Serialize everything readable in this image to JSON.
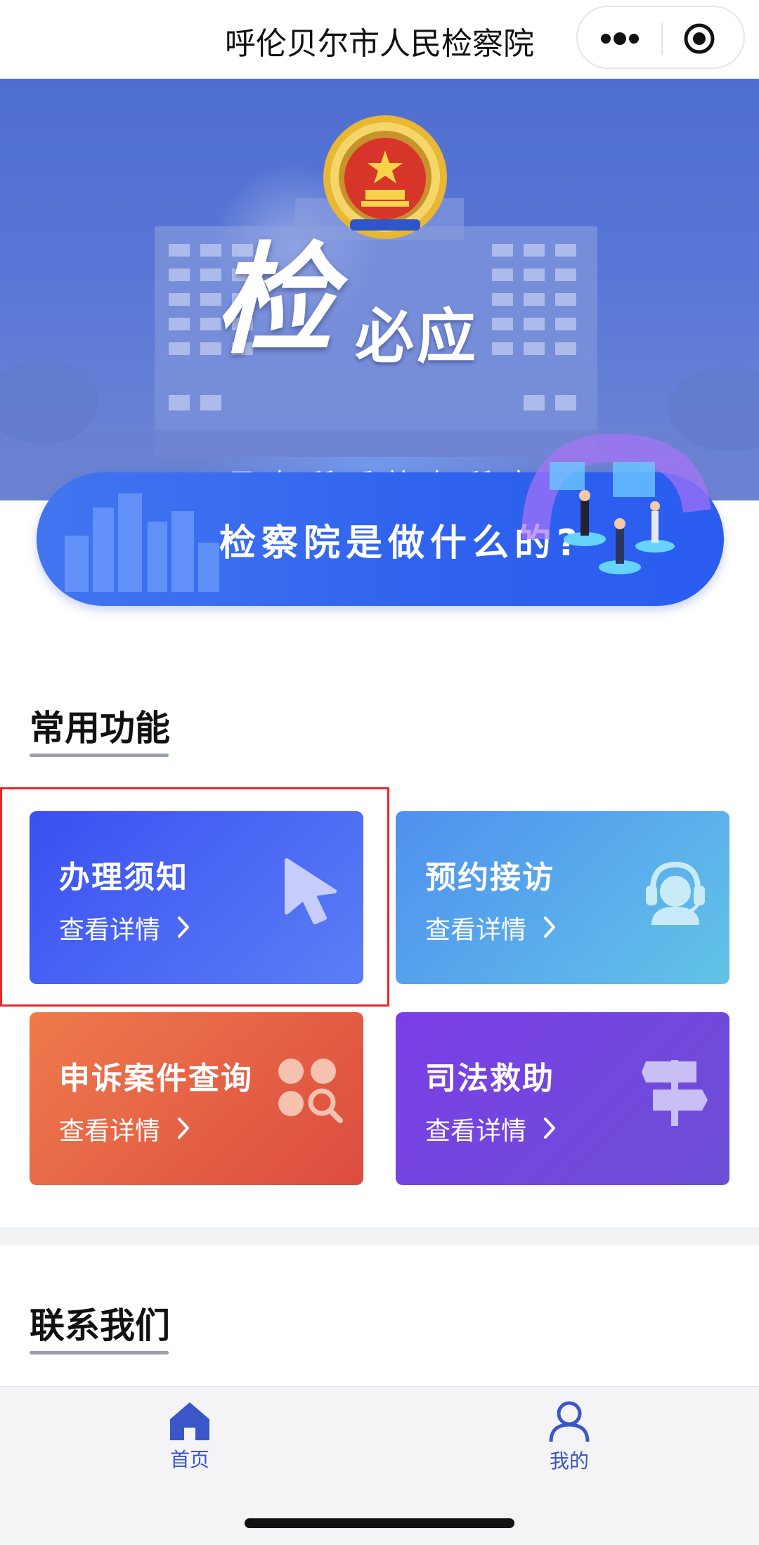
{
  "header": {
    "title": "呼伦贝尔市人民检察院"
  },
  "banner": {
    "slogan_big": "检",
    "slogan_small": "必应",
    "slogan_sub": "民有所呼检有所应"
  },
  "pill": {
    "text": "检察院是做什么的?"
  },
  "common": {
    "title": "常用功能",
    "cards": [
      {
        "title": "办理须知",
        "detail": "查看详情",
        "icon": "cursor-icon",
        "gradient": [
          "#3b4ff2",
          "#5a7ff5"
        ]
      },
      {
        "title": "预约接访",
        "detail": "查看详情",
        "icon": "headset-agent-icon",
        "gradient": [
          "#4f90ef",
          "#62c4e8"
        ]
      },
      {
        "title": "申诉案件查询",
        "detail": "查看详情",
        "icon": "grid-search-icon",
        "gradient": [
          "#ef7a4c",
          "#dc4c3f"
        ]
      },
      {
        "title": "司法救助",
        "detail": "查看详情",
        "icon": "signpost-icon",
        "gradient": [
          "#7b3ee6",
          "#6b4fd6"
        ]
      }
    ]
  },
  "contact": {
    "title": "联系我们"
  },
  "tabbar": {
    "items": [
      {
        "label": "首页",
        "icon": "home-icon",
        "active": true
      },
      {
        "label": "我的",
        "icon": "user-icon",
        "active": false
      }
    ]
  },
  "colors": {
    "accent": "#3a56c8",
    "highlight_border": "#e8282a"
  }
}
